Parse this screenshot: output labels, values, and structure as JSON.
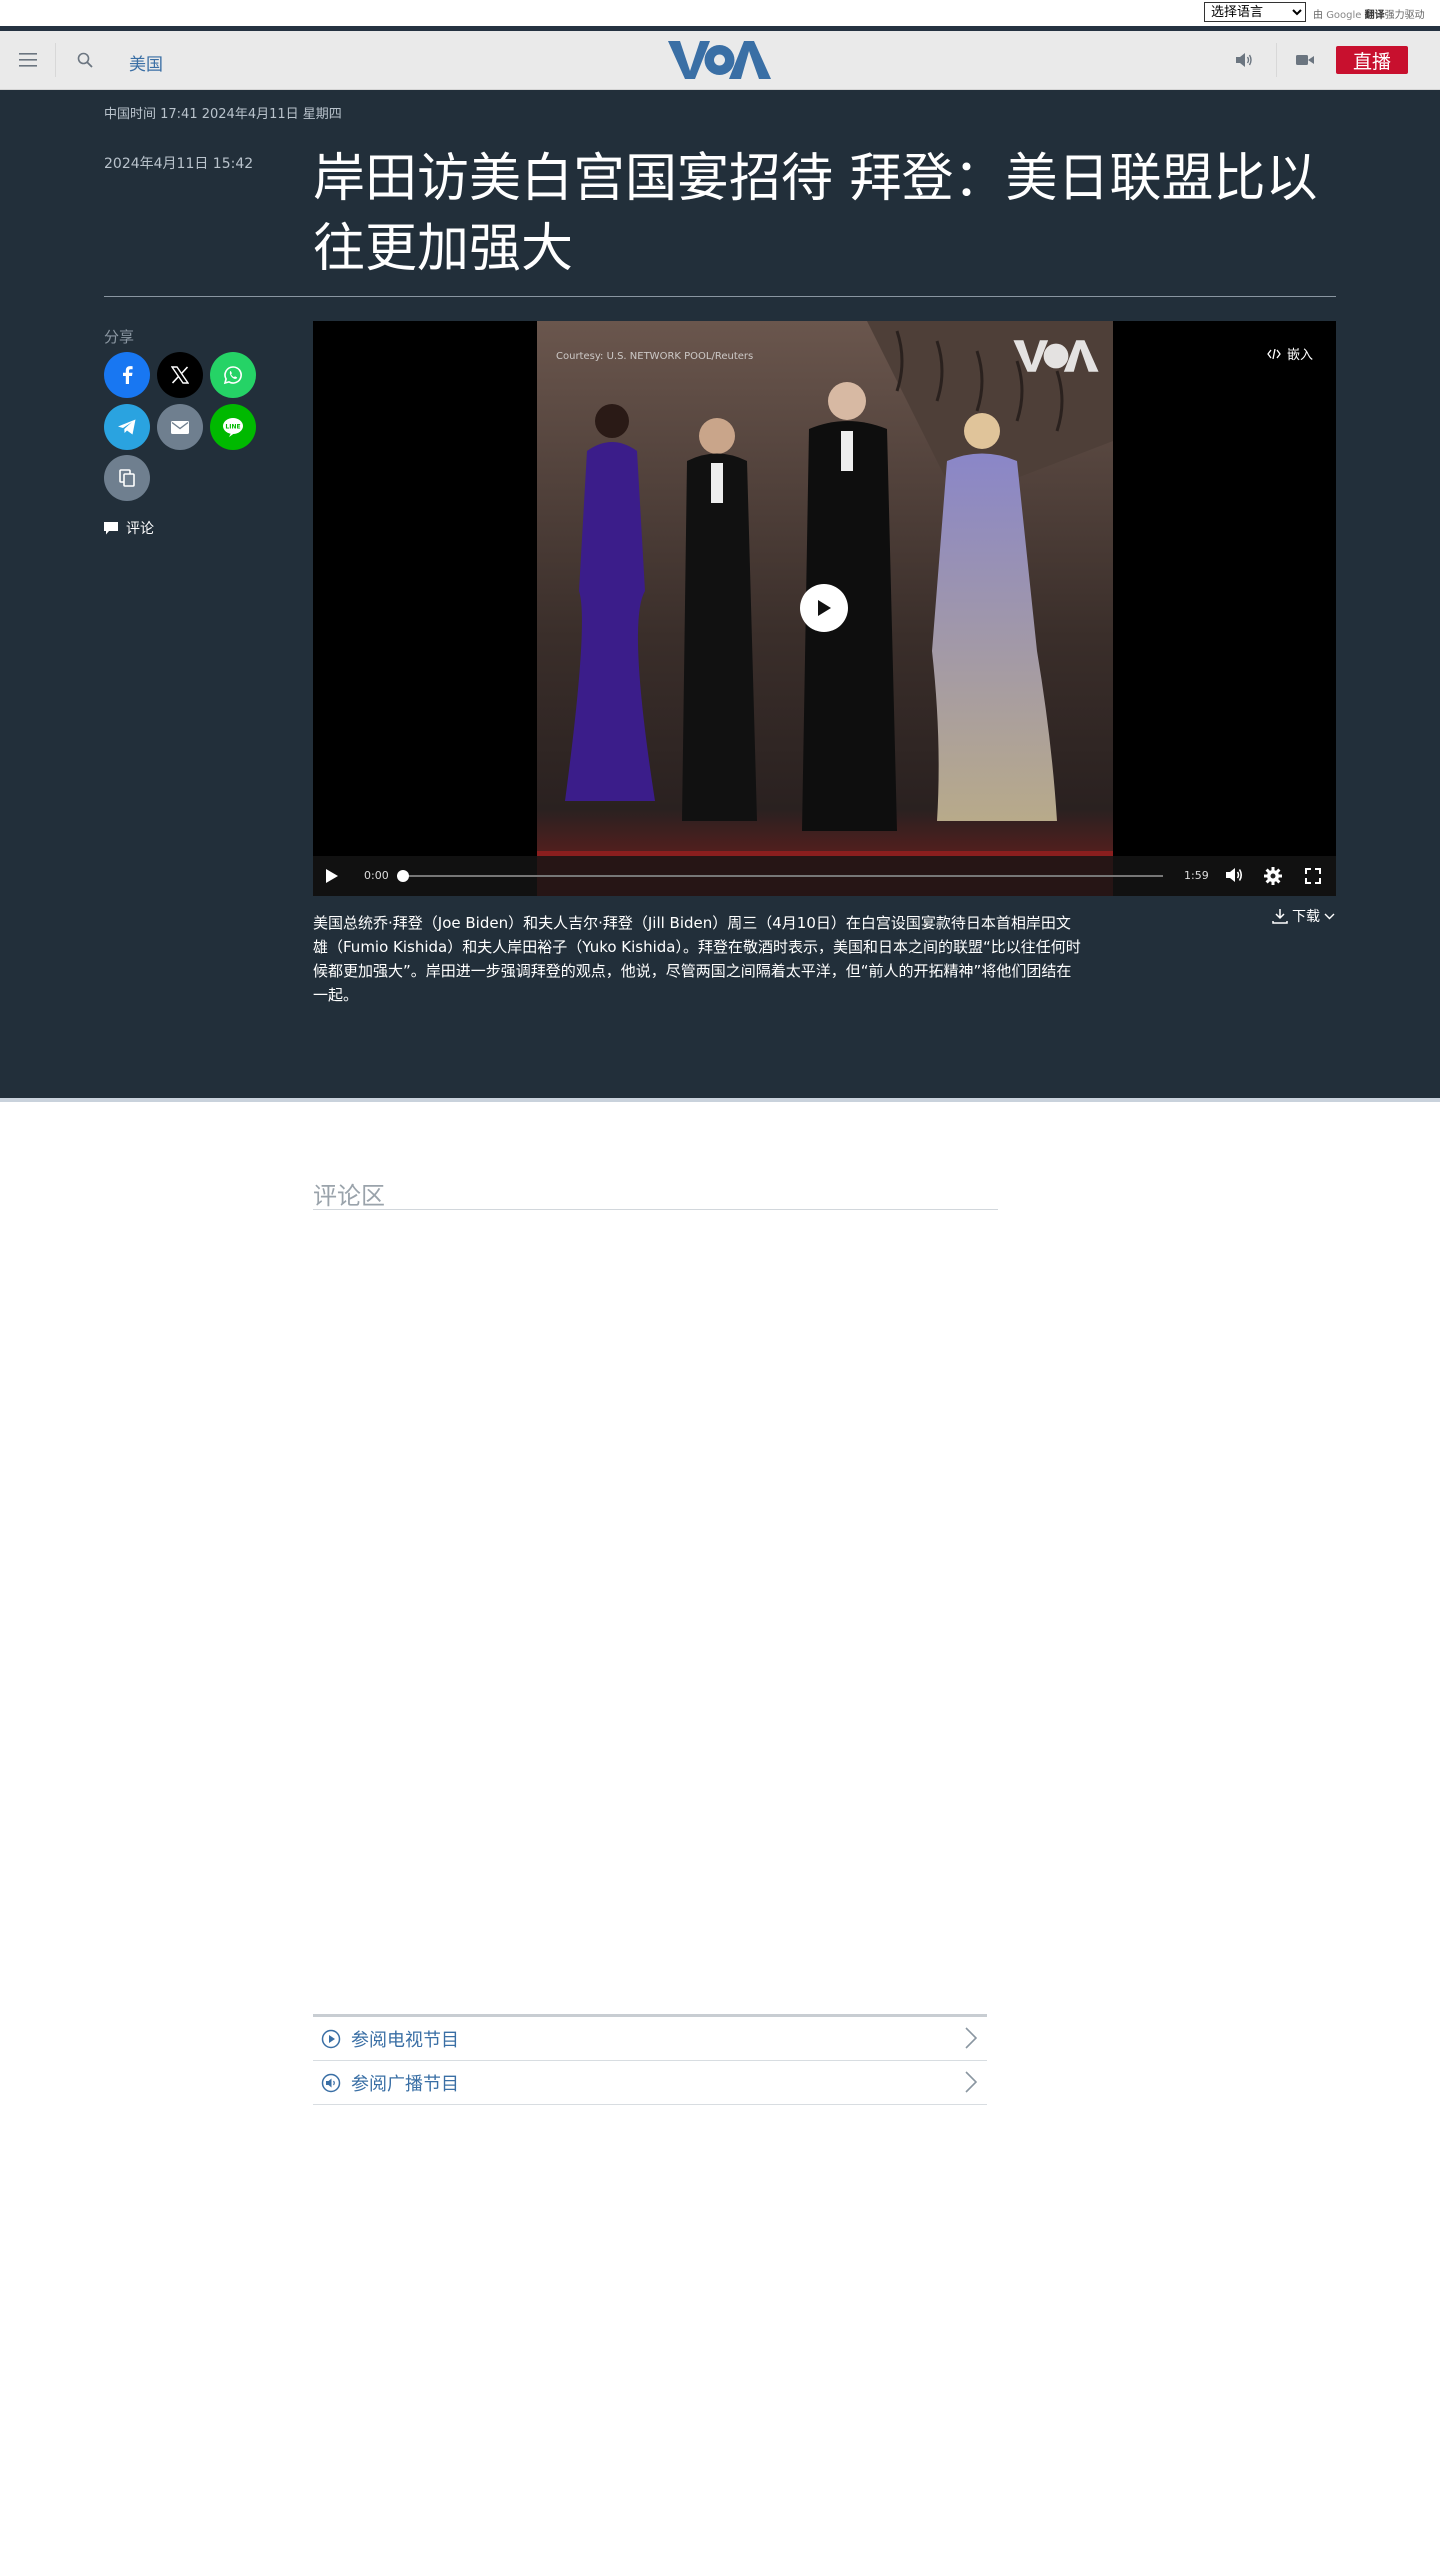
{
  "translate": {
    "select_value": "选择语言",
    "powered_prefix": "由",
    "google": "Google",
    "translate_word": "翻译",
    "powered_suffix": "强力驱动"
  },
  "header": {
    "section": "美国",
    "logo_text": "VOA",
    "live_label": "直播"
  },
  "article": {
    "timeline": "中国时间 17:41 2024年4月11日 星期四",
    "pubdate": "2024年4月11日 15:42",
    "headline": "岸田访美白宫国宴招待 拜登：美日联盟比以往更加强大",
    "share_label": "分享",
    "comment_link": "评论",
    "caption": "美国总统乔·拜登（Joe Biden）和夫人吉尔·拜登（Jill Biden）周三（4月10日）在白宫设国宴款待日本首相岸田文雄（Fumio Kishida）和夫人岸田裕子（Yuko Kishida）。拜登在敬酒时表示，美国和日本之间的联盟“比以往任何时候都更加强大”。岸田进一步强调拜登的观点，他说，尽管两国之间隔着太平洋，但“前人的开拓精神”将他们团结在一起。",
    "download_label": "下载"
  },
  "video": {
    "courtesy": "Courtesy: U.S. NETWORK POOL/Reuters",
    "watermark": "VOA",
    "embed_label": "嵌入",
    "current_time": "0:00",
    "duration": "1:59",
    "progress": 0
  },
  "comments": {
    "title": "评论区"
  },
  "links": [
    {
      "label": "参阅电视节目",
      "icon": "play-circle-icon"
    },
    {
      "label": "参阅广播节目",
      "icon": "speaker-circle-icon"
    }
  ],
  "colors": {
    "dark_bg": "#222f3a",
    "accent_blue": "#3a6fa5",
    "live_red": "#c8102e",
    "facebook": "#1877f2",
    "x": "#000000",
    "whatsapp": "#25d366",
    "telegram": "#2aa3e0",
    "email": "#6f7f8f",
    "line": "#00b900",
    "copy": "#6f7f8f"
  }
}
